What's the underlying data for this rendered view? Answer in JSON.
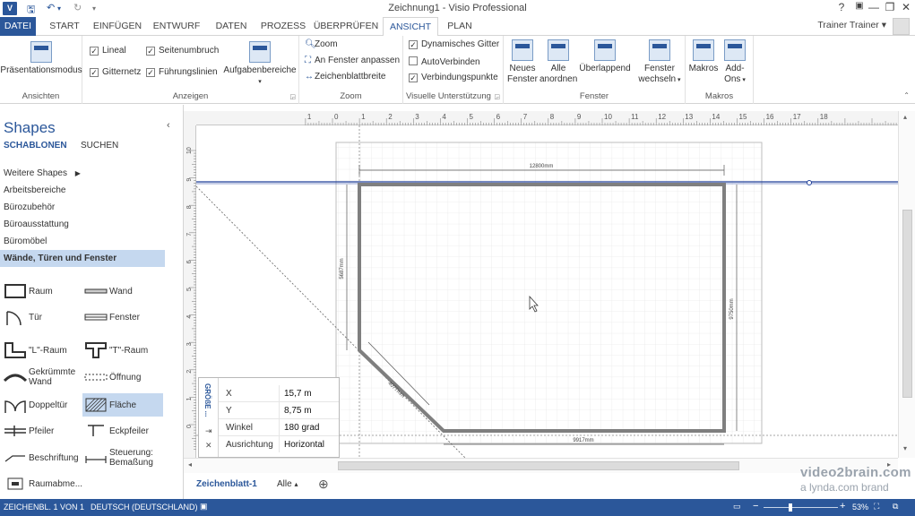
{
  "window": {
    "title": "Zeichnung1 - Visio Professional",
    "app_logo": "V",
    "help": "?",
    "ribbon_options": "▣",
    "minimize": "—",
    "restore": "❐",
    "close": "✕"
  },
  "qat": {
    "save_icon": "save-icon",
    "undo_icon": "undo-icon",
    "redo_icon": "redo-icon"
  },
  "tabs": [
    "DATEI",
    "START",
    "EINFÜGEN",
    "ENTWURF",
    "DATEN",
    "PROZESS",
    "ÜBERPRÜFEN",
    "ANSICHT",
    "PLAN"
  ],
  "active_tab": "ANSICHT",
  "user": {
    "name": "Trainer Trainer",
    "arrow": "▾"
  },
  "ribbon": {
    "ansichten": {
      "label": "Ansichten",
      "praesentation": "Präsentationsmodus"
    },
    "anzeigen": {
      "label": "Anzeigen",
      "lineal": "Lineal",
      "gitternetz": "Gitternetz",
      "seitenumbruch": "Seitenumbruch",
      "fuehrungslinien": "Führungslinien",
      "aufgabenbereiche": "Aufgabenbereiche"
    },
    "zoom": {
      "label": "Zoom",
      "zoom": "Zoom",
      "fit": "An Fenster anpassen",
      "width": "Zeichenblattbreite"
    },
    "visuelle": {
      "label": "Visuelle Unterstützung",
      "dyn_gitter": "Dynamisches Gitter",
      "autoverbinden": "AutoVerbinden",
      "verbindungspunkte": "Verbindungspunkte"
    },
    "fenster": {
      "label": "Fenster",
      "neues": [
        "Neues",
        "Fenster"
      ],
      "alle": [
        "Alle",
        "anordnen"
      ],
      "ueberlappend": "Überlappend",
      "wechseln": [
        "Fenster",
        "wechseln"
      ]
    },
    "makros": {
      "label": "Makros",
      "makros": "Makros",
      "addons": [
        "Add-",
        "Ons"
      ]
    }
  },
  "shapes_pane": {
    "heading": "Shapes",
    "collapse": "‹",
    "tab_schablonen": "SCHABLONEN",
    "tab_suchen": "SUCHEN",
    "stencils": [
      "Weitere Shapes",
      "Arbeitsbereiche",
      "Bürozubehör",
      "Büroausstattung",
      "Büromöbel",
      "Wände, Türen und Fenster"
    ],
    "more_arrow": "▶",
    "masters": [
      [
        "Raum",
        "Wand"
      ],
      [
        "Tür",
        "Fenster"
      ],
      [
        "\"L\"-Raum",
        "\"T\"-Raum"
      ],
      [
        "Gekrümmte Wand",
        "Öffnung"
      ],
      [
        "Doppeltür",
        "Fläche"
      ],
      [
        "Pfeiler",
        "Eckpfeiler"
      ],
      [
        "Beschriftung",
        "Steuerung: Bemaßung"
      ],
      [
        "Raumabme...",
        ""
      ]
    ]
  },
  "drawing": {
    "ruler_top": [
      "1",
      "0",
      "1",
      "2",
      "3",
      "4",
      "5",
      "6",
      "7",
      "8",
      "9",
      "10",
      "11",
      "12",
      "13",
      "14",
      "15",
      "16",
      "17",
      "18"
    ],
    "ruler_left": [
      "10",
      "9",
      "8",
      "7",
      "6",
      "5",
      "4",
      "3",
      "2",
      "1",
      "0"
    ],
    "dimensions": {
      "top": "12800mm",
      "left": "5687mm",
      "right": "9750mm",
      "diagonal": "4077mm",
      "bottom": "9917mm"
    }
  },
  "size_position": {
    "title": "GRÖßE ...",
    "rows": [
      {
        "key": "X",
        "value": "15,7 m"
      },
      {
        "key": "Y",
        "value": "8,75 m"
      },
      {
        "key": "Winkel",
        "value": "180 grad"
      },
      {
        "key": "Ausrichtung",
        "value": "Horizontal"
      }
    ],
    "pin_icon": "⇥",
    "close_icon": "✕"
  },
  "page_tabs": {
    "current": "Zeichenblatt-1",
    "all": "Alle",
    "all_arrow": "▴",
    "add": "⊕"
  },
  "status": {
    "page": "ZEICHENBL. 1 VON 1",
    "language": "DEUTSCH (DEUTSCHLAND)",
    "zoom": "53%",
    "minus": "−",
    "plus": "+"
  },
  "watermark": {
    "line1": "video2brain.com",
    "line2": "a lynda.com brand"
  },
  "colors": {
    "accent": "#2b579a",
    "selection": "#c5d8ef",
    "wall": "#7f7f7f",
    "guide": "#1f3f99"
  }
}
